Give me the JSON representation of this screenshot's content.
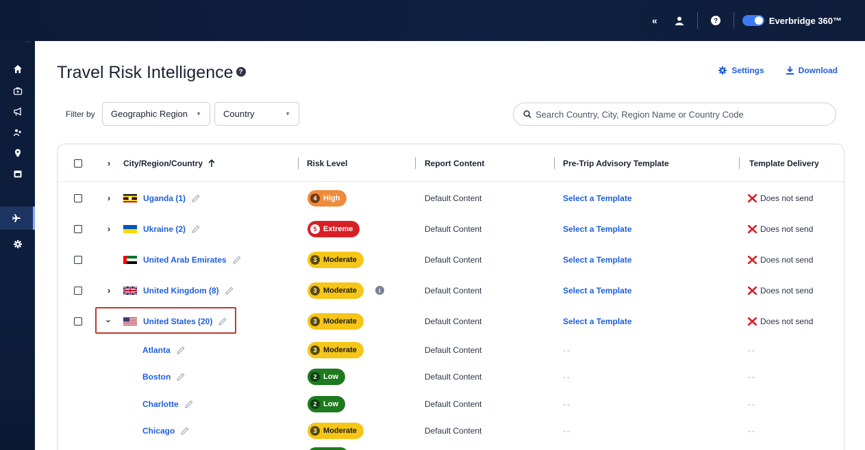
{
  "topbar": {
    "collapse_icon": "double-chevron-left-icon",
    "user_icon": "user-icon",
    "help_icon": "help-icon",
    "brand_label": "Everbridge 360™",
    "toggle_on": true
  },
  "sidebar": {
    "expand_glyph": "»",
    "items": [
      {
        "icon": "home-icon"
      },
      {
        "icon": "dashboard-icon"
      },
      {
        "icon": "megaphone-icon"
      },
      {
        "icon": "people-icon"
      },
      {
        "icon": "location-pin-icon"
      },
      {
        "icon": "calendar-icon"
      },
      {
        "icon": "airplane-icon",
        "active": true
      },
      {
        "icon": "gear-icon"
      }
    ]
  },
  "header": {
    "title": "Travel Risk Intelligence",
    "help_glyph": "?",
    "settings_label": "Settings",
    "download_label": "Download"
  },
  "filters": {
    "label": "Filter by",
    "region_value": "Geographic Region",
    "country_value": "Country",
    "search_placeholder": "Search Country, City, Region Name or Country Code"
  },
  "table": {
    "columns": [
      "City/Region/Country",
      "Risk Level",
      "Report Content",
      "Pre-Trip Advisory Template",
      "Template Delivery"
    ],
    "rows": [
      {
        "name": "Uganda (1)",
        "flag": "uganda",
        "expandable": "collapsed",
        "risk_num": "4",
        "risk_label": "High",
        "risk_level": "high",
        "content": "Default Content",
        "template": "Select a Template",
        "delivery": "Does not send"
      },
      {
        "name": "Ukraine (2)",
        "flag": "ukraine",
        "expandable": "collapsed",
        "risk_num": "5",
        "risk_label": "Extreme",
        "risk_level": "extreme",
        "content": "Default Content",
        "template": "Select a Template",
        "delivery": "Does not send"
      },
      {
        "name": "United Arab Emirates",
        "flag": "uae",
        "expandable": "none",
        "risk_num": "3",
        "risk_label": "Moderate",
        "risk_level": "moderate",
        "content": "Default Content",
        "template": "Select a Template",
        "delivery": "Does not send"
      },
      {
        "name": "United Kingdom (8)",
        "flag": "uk",
        "expandable": "collapsed",
        "risk_num": "3",
        "risk_label": "Moderate",
        "risk_level": "moderate",
        "info": "i",
        "content": "Default Content",
        "template": "Select a Template",
        "delivery": "Does not send"
      },
      {
        "name": "United States (20)",
        "flag": "us",
        "expandable": "expanded",
        "risk_num": "3",
        "risk_label": "Moderate",
        "risk_level": "moderate",
        "content": "Default Content",
        "template": "Select a Template",
        "delivery": "Does not send"
      }
    ],
    "sub_rows": [
      {
        "name": "Atlanta",
        "risk_num": "3",
        "risk_label": "Moderate",
        "risk_level": "moderate",
        "content": "Default Content",
        "template": "--",
        "delivery": "--"
      },
      {
        "name": "Boston",
        "risk_num": "2",
        "risk_label": "Low",
        "risk_level": "low",
        "content": "Default Content",
        "template": "--",
        "delivery": "--"
      },
      {
        "name": "Charlotte",
        "risk_num": "2",
        "risk_label": "Low",
        "risk_level": "low",
        "content": "Default Content",
        "template": "--",
        "delivery": "--"
      },
      {
        "name": "Chicago",
        "risk_num": "3",
        "risk_label": "Moderate",
        "risk_level": "moderate",
        "content": "Default Content",
        "template": "--",
        "delivery": "--"
      }
    ]
  },
  "colors": {
    "high": "#f08a3c",
    "extreme": "#d81f26",
    "moderate": "#f5c518",
    "low": "#1f7a1f",
    "link": "#1e5fd8",
    "highlight": "#c0392b"
  }
}
